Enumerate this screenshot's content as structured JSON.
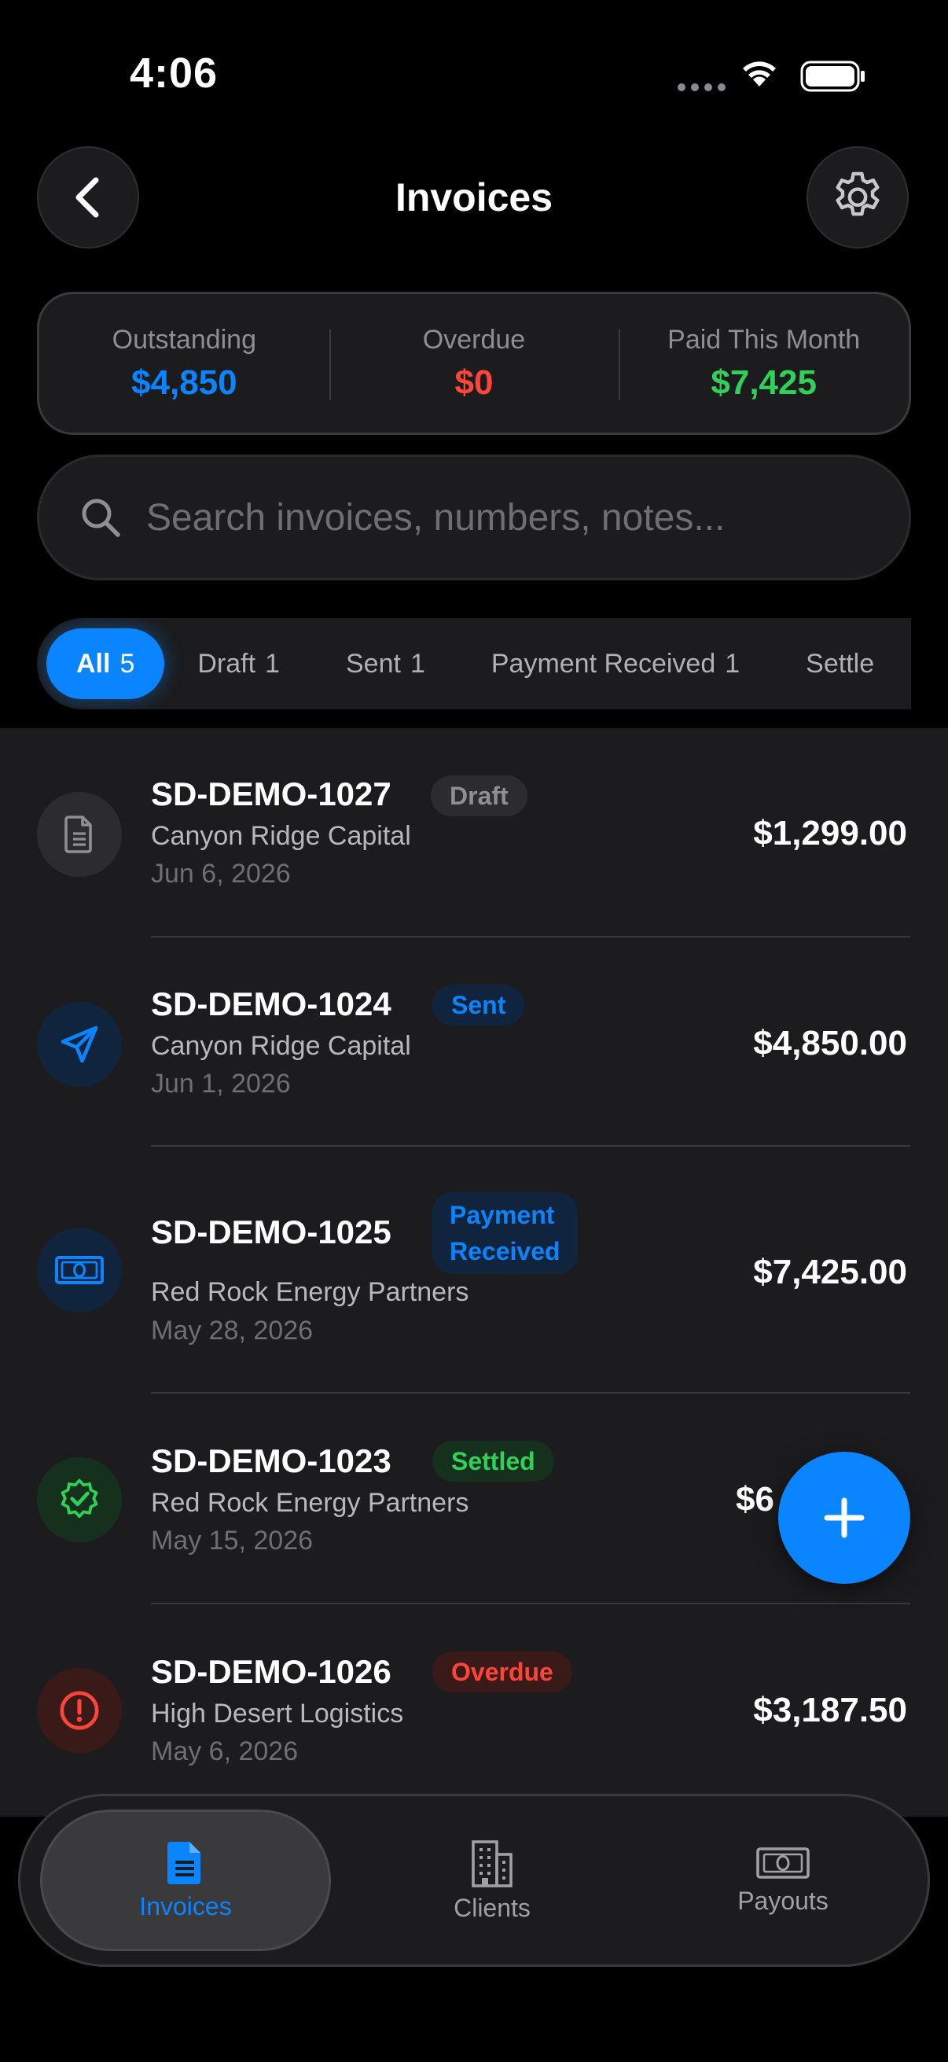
{
  "status_bar": {
    "time": "4:06"
  },
  "header": {
    "title": "Invoices",
    "back_icon": "chevron-left-icon",
    "settings_icon": "gear-icon"
  },
  "stats": [
    {
      "label": "Outstanding",
      "value": "$4,850",
      "color": "#0a84ff"
    },
    {
      "label": "Overdue",
      "value": "$0",
      "color": "#ff453a"
    },
    {
      "label": "Paid This Month",
      "value": "$7,425",
      "color": "#30d158"
    }
  ],
  "search": {
    "placeholder": "Search invoices, numbers, notes..."
  },
  "filters": [
    {
      "label": "All",
      "count": "5",
      "active": true
    },
    {
      "label": "Draft",
      "count": "1"
    },
    {
      "label": "Sent",
      "count": "1"
    },
    {
      "label": "Payment Received",
      "count": "1"
    },
    {
      "label": "Settle",
      "count": ""
    }
  ],
  "invoices": [
    {
      "number": "SD-DEMO-1027",
      "status": "Draft",
      "client": "Canyon Ridge Capital",
      "date": "Jun 6, 2026",
      "amount": "$1,299.00",
      "icon": "document-icon"
    },
    {
      "number": "SD-DEMO-1024",
      "status": "Sent",
      "client": "Canyon Ridge Capital",
      "date": "Jun 1, 2026",
      "amount": "$4,850.00",
      "icon": "paper-plane-icon"
    },
    {
      "number": "SD-DEMO-1025",
      "status_line1": "Payment",
      "status_line2": "Received",
      "client": "Red Rock Energy Partners",
      "date": "May 28, 2026",
      "amount": "$7,425.00",
      "icon": "banknote-icon"
    },
    {
      "number": "SD-DEMO-1023",
      "status": "Settled",
      "client": "Red Rock Energy Partners",
      "date": "May 15, 2026",
      "amount": "$6",
      "icon": "checkmark-seal-icon"
    },
    {
      "number": "SD-DEMO-1026",
      "status": "Overdue",
      "client": "High Desert Logistics",
      "date": "May 6, 2026",
      "amount": "$3,187.50",
      "icon": "exclamation-icon"
    }
  ],
  "fab": {
    "icon": "plus-icon"
  },
  "tab_bar": [
    {
      "label": "Invoices",
      "icon": "document-icon",
      "active": true
    },
    {
      "label": "Clients",
      "icon": "building-icon"
    },
    {
      "label": "Payouts",
      "icon": "banknote-icon"
    }
  ]
}
